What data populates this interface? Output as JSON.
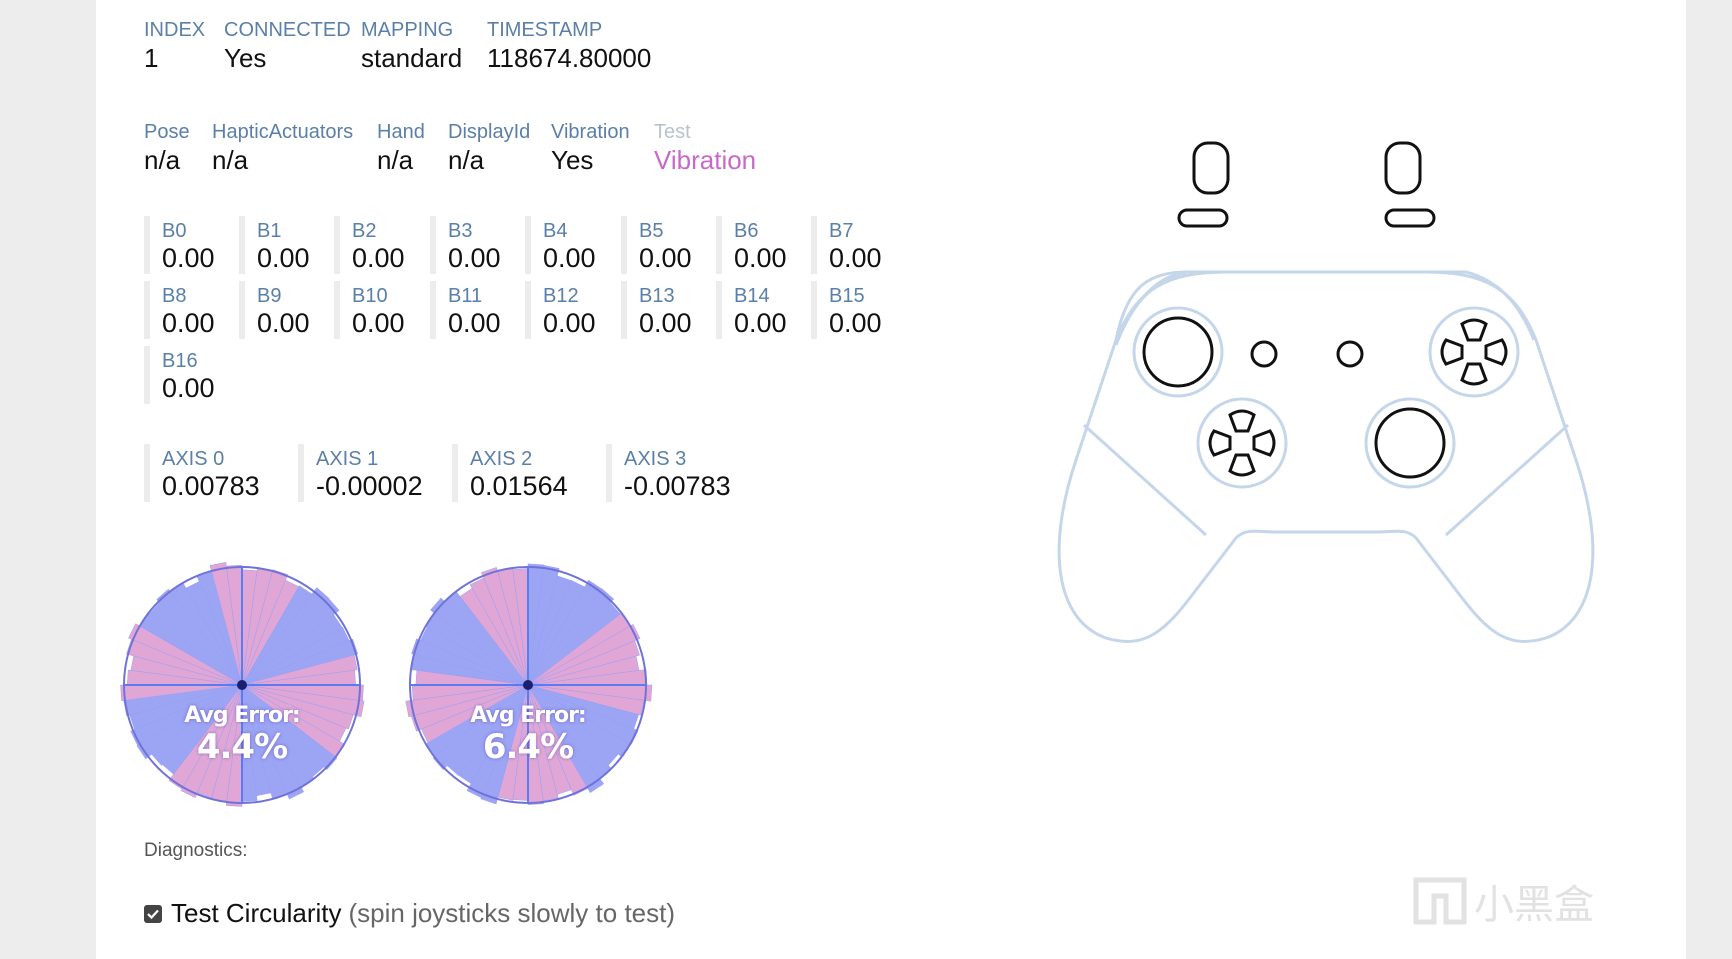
{
  "info": {
    "labels": [
      "INDEX",
      "CONNECTED",
      "MAPPING",
      "TIMESTAMP"
    ],
    "values": [
      "1",
      "Yes",
      "standard",
      "118674.80000"
    ]
  },
  "features": {
    "pose_label": "Pose",
    "pose_value": "n/a",
    "haptic_label": "HapticActuators",
    "haptic_value": "n/a",
    "hand_label": "Hand",
    "hand_value": "n/a",
    "display_label": "DisplayId",
    "display_value": "n/a",
    "vibration_label": "Vibration",
    "vibration_value": "Yes",
    "test_label": "Test",
    "test_value": "Vibration"
  },
  "buttons": [
    {
      "label": "B0",
      "value": "0.00"
    },
    {
      "label": "B1",
      "value": "0.00"
    },
    {
      "label": "B2",
      "value": "0.00"
    },
    {
      "label": "B3",
      "value": "0.00"
    },
    {
      "label": "B4",
      "value": "0.00"
    },
    {
      "label": "B5",
      "value": "0.00"
    },
    {
      "label": "B6",
      "value": "0.00"
    },
    {
      "label": "B7",
      "value": "0.00"
    },
    {
      "label": "B8",
      "value": "0.00"
    },
    {
      "label": "B9",
      "value": "0.00"
    },
    {
      "label": "B10",
      "value": "0.00"
    },
    {
      "label": "B11",
      "value": "0.00"
    },
    {
      "label": "B12",
      "value": "0.00"
    },
    {
      "label": "B13",
      "value": "0.00"
    },
    {
      "label": "B14",
      "value": "0.00"
    },
    {
      "label": "B15",
      "value": "0.00"
    },
    {
      "label": "B16",
      "value": "0.00"
    }
  ],
  "axes": [
    {
      "label": "AXIS 0",
      "value": "0.00783"
    },
    {
      "label": "AXIS 1",
      "value": "-0.00002"
    },
    {
      "label": "AXIS 2",
      "value": "0.01564"
    },
    {
      "label": "AXIS 3",
      "value": "-0.00783"
    }
  ],
  "circularity": [
    {
      "label": "Avg Error:",
      "value": "4.4%"
    },
    {
      "label": "Avg Error:",
      "value": "6.4%"
    }
  ],
  "diagnostics_label": "Diagnostics:",
  "test_circularity": {
    "label": "Test Circularity",
    "hint": "(spin joysticks slowly to test)",
    "checked": true
  },
  "watermark": "小黑盒",
  "colors": {
    "label_blue": "#5a7fa8",
    "vibration_pink": "#c76ac7",
    "gamepad_outline": "#c5d6ea",
    "stick_blue": "#7b86f0",
    "stick_pink": "#d58ac8"
  }
}
